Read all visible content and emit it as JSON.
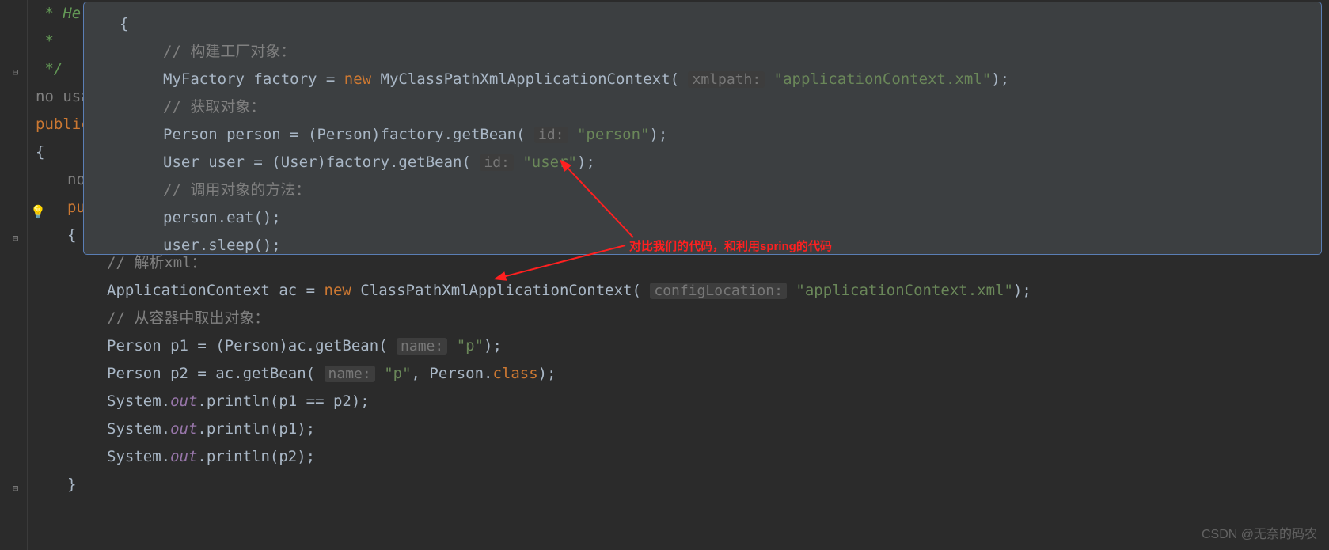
{
  "tooltip": {
    "open_brace": "{",
    "c1": "// 构建工厂对象：",
    "l2_a": "MyFactory factory = ",
    "l2_new": "new",
    "l2_b": " MyClassPathXmlApplicationContext( ",
    "l2_hint": "xmlpath:",
    "l2_str": "\"applicationContext.xml\"",
    "l2_c": ");",
    "c2": "// 获取对象：",
    "l3_a": "Person person = (Person)factory.getBean( ",
    "l3_hint": "id:",
    "l3_str": "\"person\"",
    "l3_b": ");",
    "l4_a": "User user = (User)factory.getBean( ",
    "l4_hint": "id:",
    "l4_str": "\"user\"",
    "l4_b": ");",
    "c3": "// 调用对象的方法：",
    "l5": "person.eat();",
    "l6": "user.sleep();"
  },
  "bg": {
    "doc1": " * Hel",
    "doc2": " *",
    "doc3": " */",
    "nousage": "no usag",
    "public": "public",
    "brace": "{",
    "no": "no",
    "pu": "pu",
    "brace2": "{",
    "c1": "// 解析xml：",
    "l1_a": "ApplicationContext ac = ",
    "l1_new": "new",
    "l1_b": " ClassPathXmlApplicationContext( ",
    "l1_hint": "configLocation:",
    "l1_str": "\"applicationContext.xml\"",
    "l1_c": ");",
    "c2": "// 从容器中取出对象：",
    "l2_a": "Person p1 = (Person)ac.getBean( ",
    "l2_hint": "name:",
    "l2_str": "\"p\"",
    "l2_b": ");",
    "l3_a": "Person p2 = ac.getBean( ",
    "l3_hint": "name:",
    "l3_str": "\"p\"",
    "l3_b": ", Person.",
    "l3_class": "class",
    "l3_c": ");",
    "l4_a": "System.",
    "l4_out": "out",
    "l4_b": ".println(p1 == p2);",
    "l5_a": "System.",
    "l5_out": "out",
    "l5_b": ".println(p1);",
    "l6_a": "System.",
    "l6_out": "out",
    "l6_b": ".println(p2);",
    "close": "}"
  },
  "annotation": "对比我们的代码，和利用spring的代码",
  "watermark": "CSDN @无奈的码农"
}
